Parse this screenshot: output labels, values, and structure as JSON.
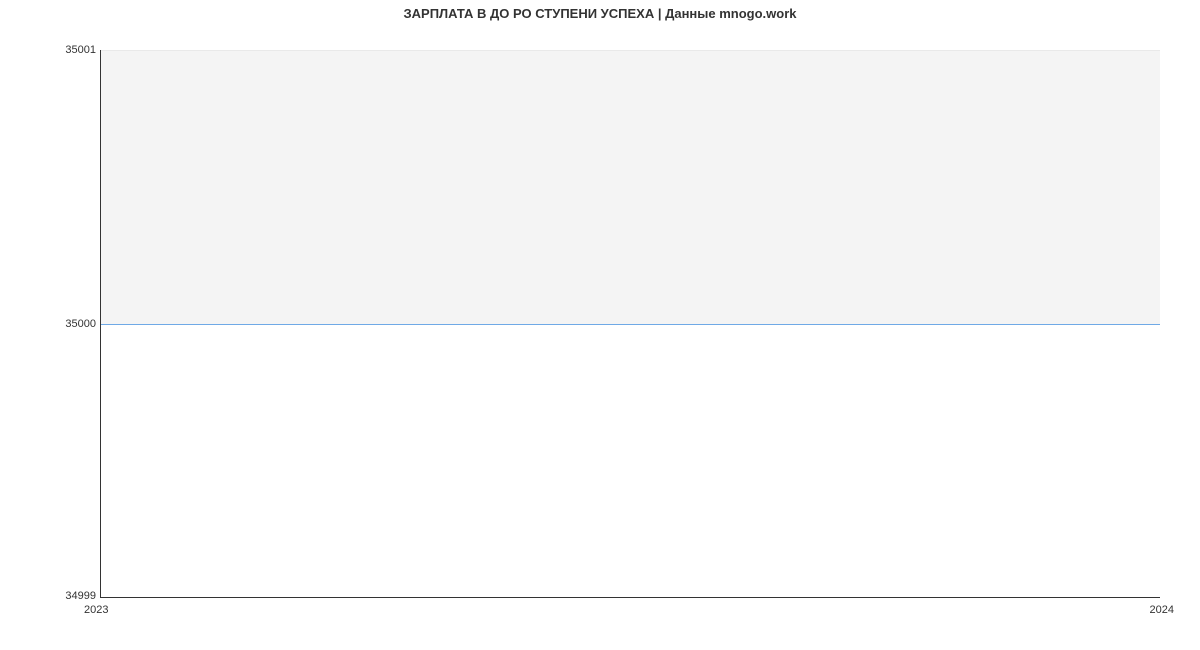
{
  "chart_data": {
    "type": "line",
    "title": "ЗАРПЛАТА В ДО РО СТУПЕНИ УСПЕХА | Данные mnogo.work",
    "xlabel": "",
    "ylabel": "",
    "x": [
      2023,
      2024
    ],
    "values": [
      35000,
      35000
    ],
    "xlim": [
      2023,
      2024
    ],
    "ylim": [
      34999,
      35001
    ],
    "y_ticks": [
      34999,
      35000,
      35001
    ],
    "x_ticks": [
      2023,
      2024
    ],
    "line_color": "#6fa9e6"
  },
  "yticks": {
    "top": "35001",
    "mid": "35000",
    "bot": "34999"
  },
  "xticks": {
    "left": "2023",
    "right": "2024"
  }
}
